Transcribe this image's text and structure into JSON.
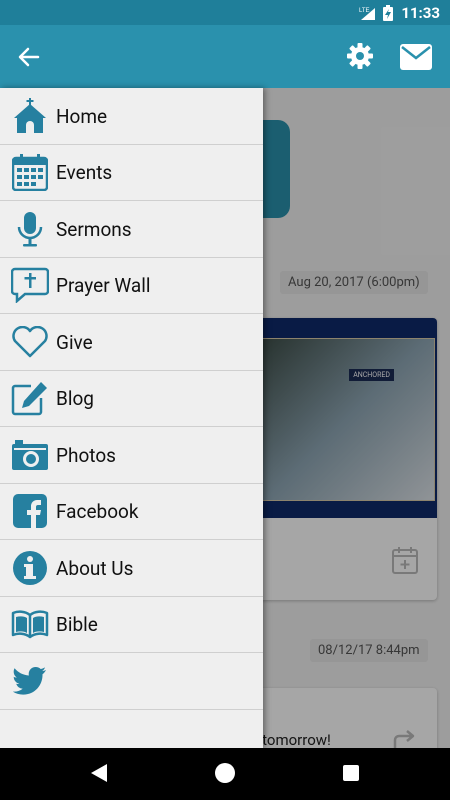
{
  "status_bar": {
    "network": "LTE",
    "time": "11:33"
  },
  "app_bar": {
    "back_icon": "arrow-left-icon",
    "settings_icon": "gear-icon",
    "mail_icon": "envelope-icon"
  },
  "drawer": {
    "items": [
      {
        "label": "Home",
        "icon": "church-icon"
      },
      {
        "label": "Events",
        "icon": "calendar-icon"
      },
      {
        "label": "Sermons",
        "icon": "microphone-icon"
      },
      {
        "label": "Prayer Wall",
        "icon": "prayer-bubble-icon"
      },
      {
        "label": "Give",
        "icon": "heart-icon"
      },
      {
        "label": "Blog",
        "icon": "pencil-edit-icon"
      },
      {
        "label": "Photos",
        "icon": "camera-icon"
      },
      {
        "label": "Facebook",
        "icon": "facebook-icon"
      },
      {
        "label": "About Us",
        "icon": "info-icon"
      },
      {
        "label": "Bible",
        "icon": "book-icon"
      },
      {
        "label": "",
        "icon": "twitter-icon"
      }
    ]
  },
  "feed": {
    "post1_date": "Aug 20, 2017 (6:00pm)",
    "post1_badge": "ANCHORED",
    "post2_date": "08/12/17 8:44pm",
    "post2_text": "g tomorrow!"
  },
  "colors": {
    "primary": "#2a91ad",
    "status_bar": "#1f7f9a",
    "icon": "#2680a0"
  }
}
